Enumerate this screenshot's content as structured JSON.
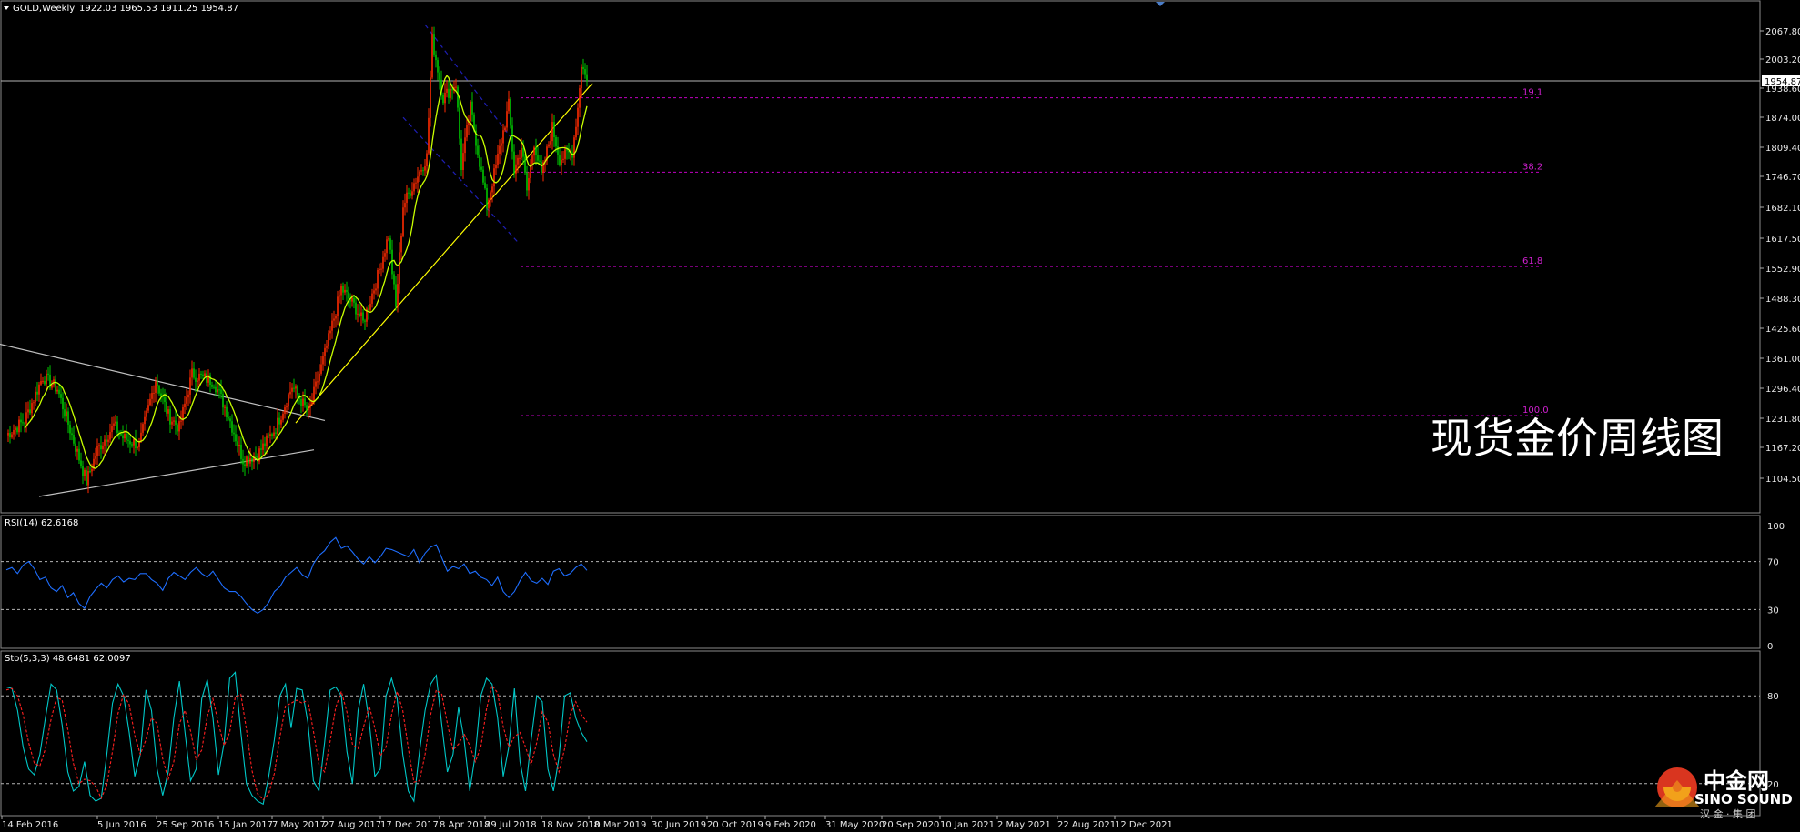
{
  "header": {
    "symbol": "GOLD,Weekly",
    "ohlc": "1922.03 1965.53 1911.25 1954.87"
  },
  "watermark": "现货金价周线图",
  "logo": {
    "cn": "中金网",
    "en": "SINO SOUND",
    "sub": "汉 金 · 集 团"
  },
  "colors": {
    "background": "#000000",
    "bull_candle": "#ff2a00",
    "bear_candle": "#00c800",
    "ma_line": "#c8ff00",
    "trendline_support": "#ffff00",
    "trendline_grey": "#c0c0c0",
    "channel": "#1e1eb4",
    "fib": "#c000c0",
    "rsi": "#1e6eff",
    "sto_main": "#00c8c8",
    "sto_signal": "#ff2020"
  },
  "chart_data": [
    {
      "type": "candlestick",
      "title": "GOLD,Weekly",
      "current_price": "1954.87",
      "ylim": [
        1104.5,
        2085
      ],
      "y_ticks": [
        "2067.80",
        "2003.20",
        "1938.60",
        "1874.00",
        "1809.40",
        "1746.70",
        "1682.10",
        "1617.50",
        "1552.90",
        "1488.30",
        "1425.60",
        "1361.00",
        "1296.40",
        "1231.80",
        "1167.20",
        "1104.50"
      ],
      "x_ticks": [
        "14 Feb 2016",
        "5 Jun 2016",
        "25 Sep 2016",
        "15 Jan 2017",
        "7 May 2017",
        "27 Aug 2017",
        "17 Dec 2017",
        "8 Apr 2018",
        "29 Jul 2018",
        "18 Nov 2018",
        "10 Mar 2019",
        "30 Jun 2019",
        "20 Oct 2019",
        "9 Feb 2020",
        "31 May 2020",
        "20 Sep 2020",
        "10 Jan 2021",
        "2 May 2021",
        "22 Aug 2021",
        "12 Dec 2021"
      ],
      "fib_levels": [
        {
          "label": "19.1",
          "price": 1920
        },
        {
          "label": "38.2",
          "price": 1768
        },
        {
          "label": "61.8",
          "price": 1575
        },
        {
          "label": "100.0",
          "price": 1270
        }
      ],
      "close_anchors": [
        {
          "date": "2016-02-14",
          "price": 1230
        },
        {
          "date": "2016-04-24",
          "price": 1260
        },
        {
          "date": "2016-07-03",
          "price": 1350
        },
        {
          "date": "2016-08-28",
          "price": 1325
        },
        {
          "date": "2016-10-02",
          "price": 1265
        },
        {
          "date": "2016-12-18",
          "price": 1135
        },
        {
          "date": "2017-01-29",
          "price": 1200
        },
        {
          "date": "2017-04-02",
          "price": 1250
        },
        {
          "date": "2017-05-07",
          "price": 1225
        },
        {
          "date": "2017-07-09",
          "price": 1210
        },
        {
          "date": "2017-09-10",
          "price": 1345
        },
        {
          "date": "2017-10-29",
          "price": 1270
        },
        {
          "date": "2017-12-10",
          "price": 1245
        },
        {
          "date": "2018-01-28",
          "price": 1355
        },
        {
          "date": "2018-04-22",
          "price": 1340
        },
        {
          "date": "2018-06-17",
          "price": 1270
        },
        {
          "date": "2018-08-12",
          "price": 1180
        },
        {
          "date": "2018-10-07",
          "price": 1190
        },
        {
          "date": "2018-12-16",
          "price": 1245
        },
        {
          "date": "2019-02-17",
          "price": 1330
        },
        {
          "date": "2019-04-21",
          "price": 1275
        },
        {
          "date": "2019-06-30",
          "price": 1410
        },
        {
          "date": "2019-08-25",
          "price": 1530
        },
        {
          "date": "2019-10-20",
          "price": 1490
        },
        {
          "date": "2019-11-17",
          "price": 1460
        },
        {
          "date": "2020-01-12",
          "price": 1555
        },
        {
          "date": "2020-02-23",
          "price": 1640
        },
        {
          "date": "2020-03-22",
          "price": 1490
        },
        {
          "date": "2020-04-19",
          "price": 1700
        },
        {
          "date": "2020-07-19",
          "price": 1800
        },
        {
          "date": "2020-08-09",
          "price": 2040
        },
        {
          "date": "2020-09-20",
          "price": 1920
        },
        {
          "date": "2020-11-08",
          "price": 1950
        },
        {
          "date": "2020-11-29",
          "price": 1780
        },
        {
          "date": "2021-01-03",
          "price": 1900
        },
        {
          "date": "2021-03-07",
          "price": 1700
        },
        {
          "date": "2021-04-11",
          "price": 1780
        },
        {
          "date": "2021-05-30",
          "price": 1905
        },
        {
          "date": "2021-06-20",
          "price": 1770
        },
        {
          "date": "2021-07-18",
          "price": 1820
        },
        {
          "date": "2021-08-08",
          "price": 1730
        },
        {
          "date": "2021-09-05",
          "price": 1830
        },
        {
          "date": "2021-10-03",
          "price": 1760
        },
        {
          "date": "2021-11-14",
          "price": 1860
        },
        {
          "date": "2021-12-12",
          "price": 1795
        },
        {
          "date": "2022-01-30",
          "price": 1810
        },
        {
          "date": "2022-02-20",
          "price": 1900
        },
        {
          "date": "2022-03-06",
          "price": 1990
        },
        {
          "date": "2022-03-27",
          "price": 1954.87
        }
      ],
      "ma_line": {
        "period": 10
      },
      "annotations": {
        "support_trendline": [
          {
            "date": "2019-03-03",
            "price": 1255
          },
          {
            "date": "2022-04-17",
            "price": 1950
          }
        ],
        "grey_descending_line": [
          {
            "date": "2015-12-20",
            "price": 1420
          },
          {
            "date": "2019-06-23",
            "price": 1260
          }
        ],
        "grey_ascending_line": [
          {
            "date": "2016-06-19",
            "price": 1104.5
          },
          {
            "date": "2019-05-12",
            "price": 1200
          }
        ],
        "channel_upper": [
          {
            "date": "2020-07-12",
            "price": 2070
          },
          {
            "date": "2021-06-06",
            "price": 1840
          }
        ],
        "channel_lower": [
          {
            "date": "2020-04-19",
            "price": 1880
          },
          {
            "date": "2021-07-04",
            "price": 1625
          }
        ]
      }
    },
    {
      "type": "line",
      "title": "RSI(14) 62.6168",
      "ylim": [
        0,
        100
      ],
      "y_ticks": [
        "100",
        "70",
        "30",
        "0"
      ],
      "levels": [
        70,
        30
      ],
      "series": [
        {
          "name": "RSI(14)",
          "values": [
            63,
            65,
            60,
            67,
            70,
            64,
            55,
            57,
            48,
            45,
            50,
            40,
            44,
            35,
            31,
            41,
            47,
            52,
            48,
            55,
            58,
            53,
            56,
            55,
            60,
            60,
            55,
            52,
            46,
            56,
            61,
            58,
            55,
            61,
            65,
            60,
            57,
            62,
            55,
            48,
            45,
            45,
            41,
            35,
            30,
            27,
            30,
            36,
            45,
            49,
            57,
            61,
            65,
            59,
            56,
            68,
            75,
            79,
            86,
            90,
            81,
            83,
            78,
            72,
            68,
            74,
            69,
            74,
            81,
            80,
            78,
            76,
            74,
            80,
            69,
            77,
            82,
            84,
            73,
            62,
            66,
            64,
            68,
            60,
            62,
            57,
            55,
            50,
            57,
            45,
            40,
            45,
            54,
            61,
            54,
            52,
            56,
            51,
            62,
            64,
            58,
            60,
            65,
            68,
            62.6168
          ]
        }
      ]
    },
    {
      "type": "line",
      "title": "Sto(5,3,3) 48.6481 62.0097",
      "ylim": [
        0,
        100
      ],
      "y_ticks": [
        "80",
        "20"
      ],
      "levels": [
        80,
        20
      ],
      "series": [
        {
          "name": "main",
          "values": [
            86,
            85,
            70,
            45,
            30,
            26,
            40,
            65,
            88,
            84,
            60,
            28,
            15,
            18,
            35,
            12,
            8,
            10,
            40,
            75,
            88,
            80,
            55,
            25,
            40,
            84,
            70,
            30,
            12,
            28,
            65,
            90,
            55,
            22,
            30,
            78,
            91,
            65,
            26,
            48,
            92,
            96,
            55,
            20,
            12,
            8,
            6,
            25,
            50,
            80,
            88,
            58,
            85,
            84,
            62,
            22,
            15,
            48,
            84,
            86,
            80,
            42,
            20,
            70,
            88,
            62,
            25,
            30,
            80,
            92,
            78,
            40,
            15,
            8,
            42,
            70,
            88,
            94,
            60,
            28,
            40,
            72,
            50,
            15,
            40,
            80,
            92,
            88,
            65,
            25,
            45,
            85,
            35,
            15,
            50,
            80,
            76,
            30,
            15,
            38,
            80,
            82,
            65,
            55,
            48.6481
          ]
        },
        {
          "name": "signal",
          "values": [
            84,
            85,
            80,
            67,
            48,
            34,
            32,
            44,
            64,
            79,
            77,
            57,
            34,
            20,
            23,
            22,
            18,
            10,
            19,
            42,
            68,
            81,
            74,
            53,
            40,
            50,
            65,
            61,
            37,
            23,
            35,
            61,
            70,
            56,
            36,
            43,
            66,
            78,
            61,
            46,
            55,
            79,
            81,
            57,
            29,
            13,
            9,
            13,
            27,
            52,
            73,
            75,
            77,
            75,
            77,
            56,
            33,
            28,
            49,
            72,
            83,
            69,
            47,
            44,
            59,
            73,
            58,
            39,
            45,
            67,
            83,
            70,
            44,
            21,
            22,
            40,
            67,
            84,
            81,
            61,
            43,
            47,
            54,
            46,
            35,
            45,
            71,
            87,
            82,
            59,
            45,
            52,
            55,
            45,
            33,
            48,
            69,
            62,
            40,
            28,
            44,
            67,
            76,
            67,
            62.0097
          ]
        }
      ]
    }
  ]
}
